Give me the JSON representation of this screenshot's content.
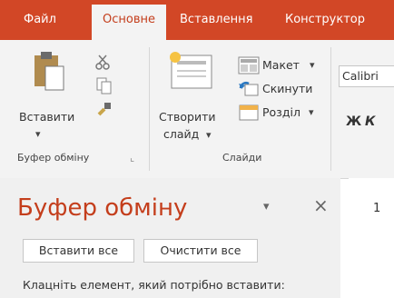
{
  "tabs": [
    "Файл",
    "Основне",
    "Вставлення",
    "Конструктор"
  ],
  "ribbon": {
    "clipboard": {
      "paste": "Вставити",
      "group": "Буфер обміну"
    },
    "slides": {
      "new_slide_line1": "Створити",
      "new_slide_line2": "слайд",
      "layout": "Макет",
      "reset": "Скинути",
      "section": "Розділ",
      "group": "Слайди"
    },
    "font": {
      "name": "Calibri",
      "bold": "Ж",
      "italic": "К"
    }
  },
  "pane": {
    "title": "Буфер обміну",
    "paste_all": "Вставити все",
    "clear_all": "Очистити все",
    "instruction": "Клацніть елемент, який потрібно вставити:",
    "close": "×",
    "dropdown": "▾"
  },
  "slide_number": "1",
  "colors": {
    "accent": "#d24726",
    "title": "#c43e1c"
  }
}
